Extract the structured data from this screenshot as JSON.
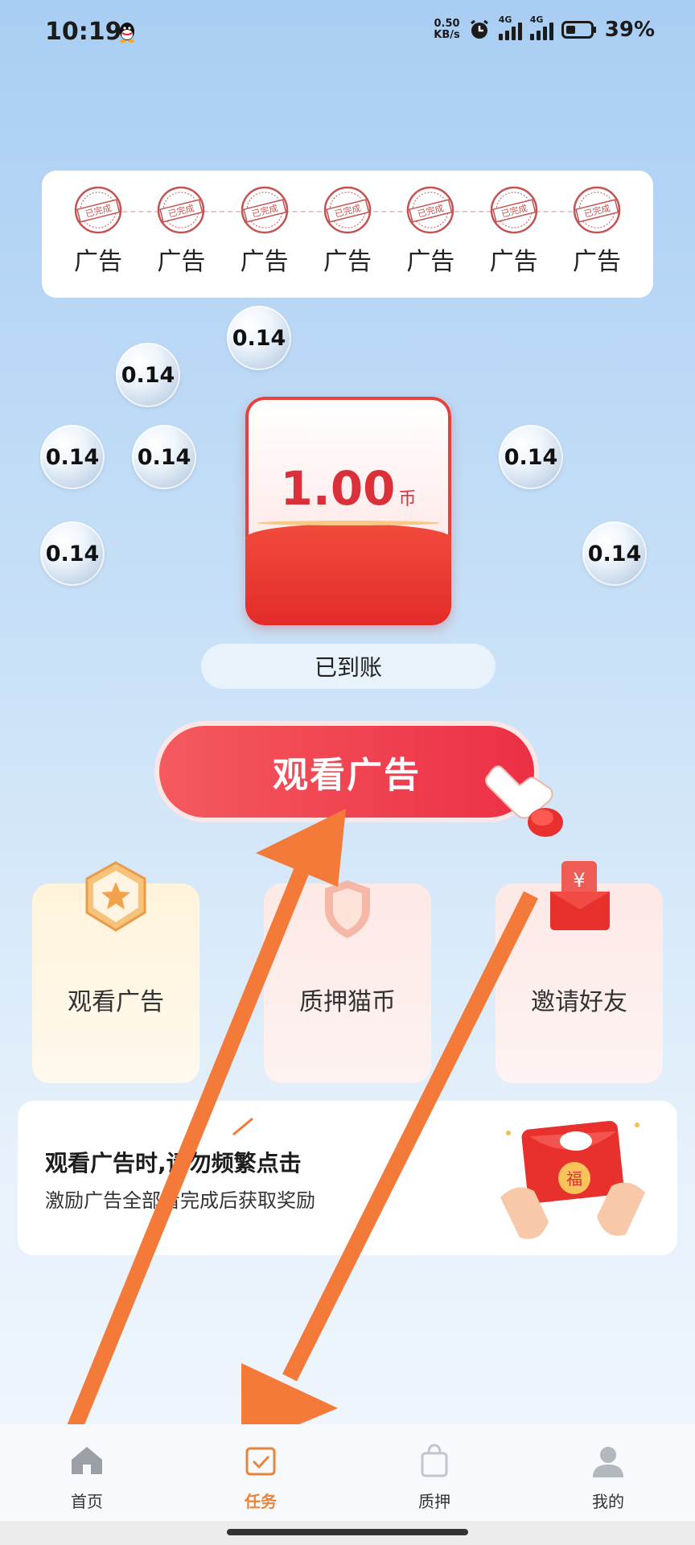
{
  "status_bar": {
    "time": "10:19",
    "net_speed_value": "0.50",
    "net_speed_unit": "KB/s",
    "signal1_label": "4G",
    "signal2_label": "4G",
    "battery": "39%"
  },
  "ad_progress": {
    "items": [
      {
        "label": "广告",
        "stamp": "已完成"
      },
      {
        "label": "广告",
        "stamp": "已完成"
      },
      {
        "label": "广告",
        "stamp": "已完成"
      },
      {
        "label": "广告",
        "stamp": "已完成"
      },
      {
        "label": "广告",
        "stamp": "已完成"
      },
      {
        "label": "广告",
        "stamp": "已完成"
      },
      {
        "label": "广告",
        "stamp": "已完成"
      }
    ]
  },
  "bubbles": [
    "0.14",
    "0.14",
    "0.14",
    "0.14",
    "0.14",
    "0.14",
    "0.14"
  ],
  "red_packet": {
    "amount": "1.00",
    "unit": "币",
    "status": "已到账"
  },
  "watch_button": "观看广告",
  "features": [
    {
      "label": "观看广告",
      "icon": "star-badge-icon"
    },
    {
      "label": "质押猫币",
      "icon": "shield-icon"
    },
    {
      "label": "邀请好友",
      "icon": "red-envelope-icon"
    }
  ],
  "tip": {
    "title": "观看广告时,请勿频繁点击",
    "subtitle": "激励广告全部看完成后获取奖励"
  },
  "tabs": [
    {
      "label": "首页",
      "icon": "home-icon"
    },
    {
      "label": "任务",
      "icon": "task-icon"
    },
    {
      "label": "质押",
      "icon": "bag-icon"
    },
    {
      "label": "我的",
      "icon": "user-icon"
    }
  ],
  "colors": {
    "accent_red": "#ec2f46",
    "active_tab": "#e8853a",
    "overlay_arrow": "#f47a3a"
  }
}
